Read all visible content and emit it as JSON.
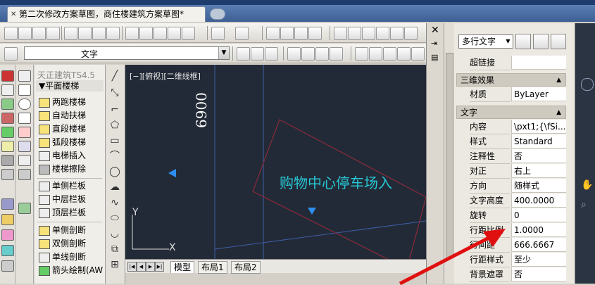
{
  "app": {
    "doc_title": "第二次修改方案草图，商住楼建筑方案草图*"
  },
  "layer_combo": {
    "value": "文字"
  },
  "tianzheng": {
    "title": "天正建筑TS4.5",
    "section": "平面楼梯",
    "items": [
      "两跑楼梯",
      "自动扶梯",
      "直段楼梯",
      "弧段楼梯",
      "电梯插入",
      "楼梯擦除",
      "单侧栏板",
      "中层栏板",
      "顶层栏板",
      "单侧剖断",
      "双侧剖断",
      "单线剖断",
      "箭头绘制(AW"
    ]
  },
  "canvas": {
    "viewport_label": "[−][俯视][二维线框]",
    "dimension": "6900",
    "text_object": "购物中心停车场入",
    "ucs_y": "Y",
    "ucs_x": "X"
  },
  "layout_tabs": [
    "模型",
    "布局1",
    "布局2"
  ],
  "properties": {
    "object_type": "多行文字",
    "rows_top": [
      {
        "name": "超链接",
        "value": ""
      }
    ],
    "cat_3d": "三维效果",
    "rows_3d": [
      {
        "name": "材质",
        "value": "ByLayer"
      }
    ],
    "cat_text": "文字",
    "rows_text": [
      {
        "name": "内容",
        "value": "\\pxt1;{\\fSi..."
      },
      {
        "name": "样式",
        "value": "Standard"
      },
      {
        "name": "注释性",
        "value": "否"
      },
      {
        "name": "对正",
        "value": "右上"
      },
      {
        "name": "方向",
        "value": "随样式"
      },
      {
        "name": "文字高度",
        "value": "400.0000"
      },
      {
        "name": "旋转",
        "value": "0"
      },
      {
        "name": "行距比例",
        "value": "1.0000"
      },
      {
        "name": "行间距",
        "value": "666.6667"
      },
      {
        "name": "行距样式",
        "value": "至少"
      },
      {
        "name": "背景遮罩",
        "value": "否"
      }
    ]
  },
  "colors": {
    "canvas_bg": "#232a37",
    "text_object": "#27c7d4",
    "annotation_arrow": "#e01010",
    "boundary": "#8a2a3a"
  }
}
